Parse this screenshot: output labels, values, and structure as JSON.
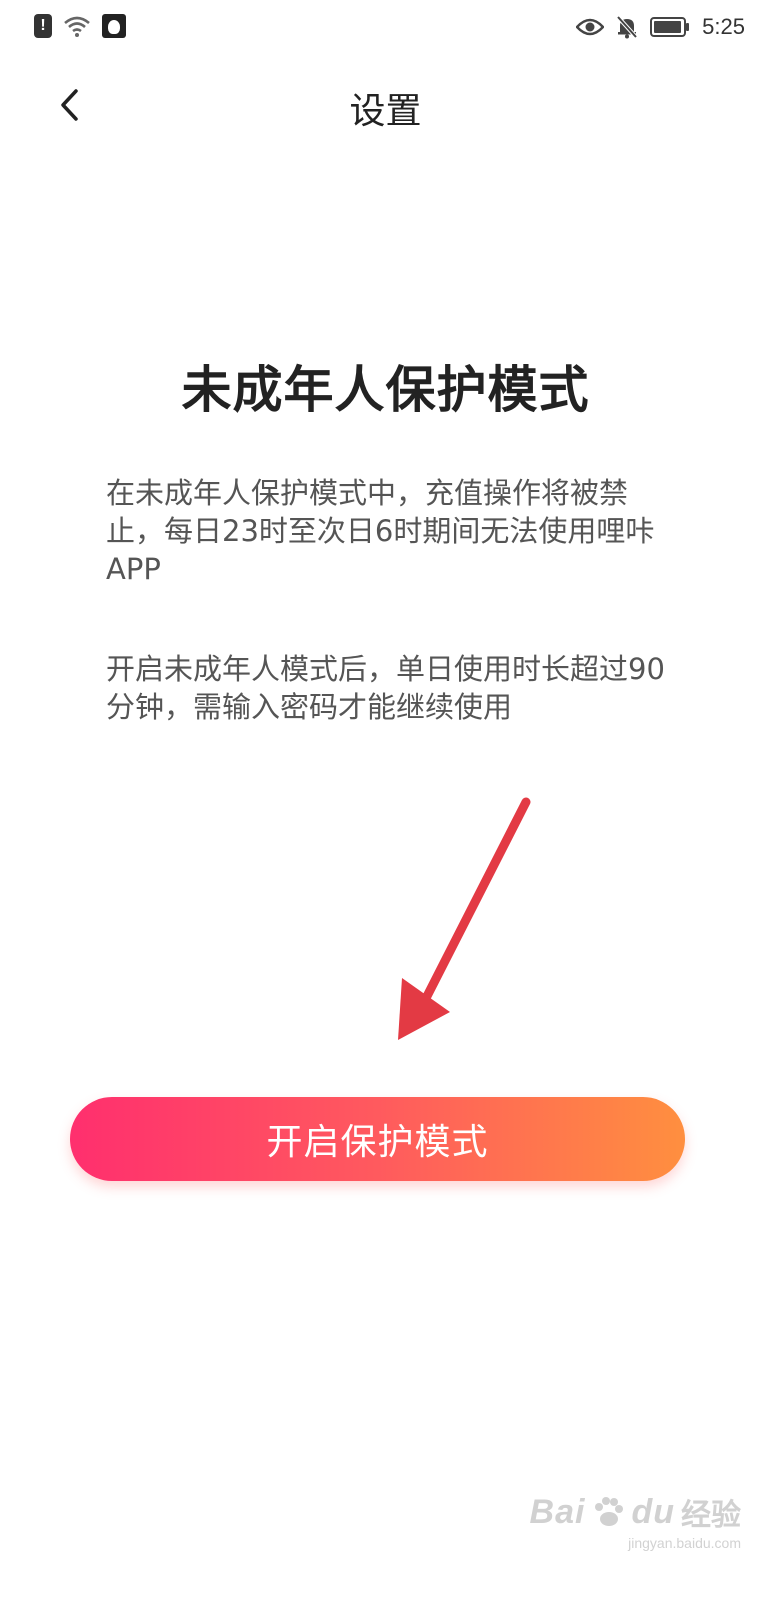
{
  "status_bar": {
    "time": "5:25",
    "alert_badge": "!"
  },
  "nav": {
    "title": "设置"
  },
  "main": {
    "title": "未成年人保护模式",
    "paragraph_1": "在未成年人保护模式中，充值操作将被禁止，每日23时至次日6时期间无法使用哩咔APP",
    "paragraph_2": "开启未成年人模式后，单日使用时长超过90分钟，需输入密码才能继续使用",
    "button_label": "开启保护模式"
  },
  "watermark": {
    "logo": "Bai",
    "logo_suffix": "du",
    "cn": "经验",
    "url": "jingyan.baidu.com"
  },
  "colors": {
    "button_gradient_start": "#ff2f6e",
    "button_gradient_end": "#ff8f3f",
    "arrow": "#e33a44"
  },
  "icons": [
    "alert-icon",
    "wifi-icon",
    "app-avatar-icon",
    "eye-icon",
    "bell-off-icon",
    "battery-icon",
    "back-arrow-icon"
  ]
}
